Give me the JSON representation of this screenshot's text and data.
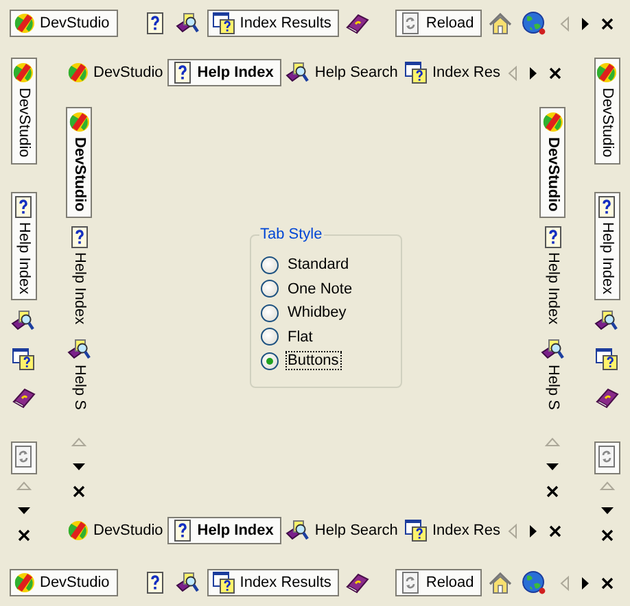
{
  "outer_top": {
    "kind": "button_groups",
    "groups": [
      {
        "tabs": [
          {
            "kind": "devstudio",
            "label": "DevStudio",
            "selected": true
          }
        ]
      },
      {
        "tabs": [
          {
            "kind": "help",
            "selected": false
          },
          {
            "kind": "search",
            "selected": false
          },
          {
            "kind": "results",
            "label": "Index Results",
            "selected": true
          },
          {
            "kind": "book",
            "selected": false
          }
        ]
      },
      {
        "tabs": [
          {
            "kind": "reload",
            "label": "Reload",
            "selected": true
          },
          {
            "kind": "home",
            "selected": false
          },
          {
            "kind": "globe",
            "selected": false
          }
        ]
      }
    ],
    "scroll_back": {
      "disabled": true
    },
    "scroll_forward": {
      "disabled": false
    }
  },
  "outer_left": {
    "kind": "button_groups",
    "groups": [
      {
        "tabs": [
          {
            "kind": "devstudio",
            "label": "DevStudio",
            "selected": true
          }
        ]
      },
      {
        "tabs": [
          {
            "kind": "help",
            "label": "Help Index",
            "selected": true
          },
          {
            "kind": "search",
            "selected": false
          },
          {
            "kind": "results",
            "selected": false
          },
          {
            "kind": "book",
            "selected": false
          }
        ]
      },
      {
        "tabs": [
          {
            "kind": "reload",
            "selected": true
          }
        ]
      }
    ],
    "scroll_back": {
      "disabled": true
    },
    "scroll_forward": {
      "disabled": false
    }
  },
  "inner_top": {
    "kind": "tab_list",
    "tabs": [
      {
        "kind": "devstudio",
        "label": "DevStudio",
        "selected": false
      },
      {
        "kind": "help",
        "label": "Help Index",
        "selected": true
      },
      {
        "kind": "search",
        "label": "Help Search",
        "selected": false
      },
      {
        "kind": "results",
        "label": "Index Res",
        "selected": false
      }
    ],
    "scroll_back": {
      "disabled": true
    },
    "scroll_forward": {
      "disabled": false
    }
  },
  "inner_left": {
    "kind": "tab_list",
    "tabs": [
      {
        "kind": "devstudio",
        "label": "DevStudio",
        "selected": true
      },
      {
        "kind": "help",
        "label": "Help Index",
        "selected": false
      },
      {
        "kind": "search",
        "label": "Help S",
        "selected": false
      }
    ],
    "scroll_back": {
      "disabled": true
    },
    "scroll_forward": {
      "disabled": false
    }
  },
  "tab_style": {
    "title": "Tab Style",
    "options": [
      {
        "label": "Standard",
        "selected": false
      },
      {
        "label": "One Note",
        "selected": false
      },
      {
        "label": "Whidbey",
        "selected": false
      },
      {
        "label": "Flat",
        "selected": false
      },
      {
        "label": "Buttons",
        "selected": true
      }
    ]
  },
  "inner_right": {
    "kind": "tab_list",
    "tabs": [
      {
        "kind": "devstudio",
        "label": "DevStudio",
        "selected": true
      },
      {
        "kind": "help",
        "label": "Help Index",
        "selected": false
      },
      {
        "kind": "search",
        "label": "Help S",
        "selected": false
      }
    ],
    "scroll_back": {
      "disabled": true
    },
    "scroll_forward": {
      "disabled": false
    }
  },
  "outer_right": {
    "kind": "button_groups",
    "groups": [
      {
        "tabs": [
          {
            "kind": "devstudio",
            "label": "DevStudio",
            "selected": true
          }
        ]
      },
      {
        "tabs": [
          {
            "kind": "help",
            "label": "Help Index",
            "selected": true
          },
          {
            "kind": "search",
            "selected": false
          },
          {
            "kind": "results",
            "selected": false
          },
          {
            "kind": "book",
            "selected": false
          }
        ]
      },
      {
        "tabs": [
          {
            "kind": "reload",
            "selected": true
          }
        ]
      }
    ],
    "scroll_back": {
      "disabled": true
    },
    "scroll_forward": {
      "disabled": false
    }
  },
  "inner_bottom": {
    "kind": "tab_list",
    "tabs": [
      {
        "kind": "devstudio",
        "label": "DevStudio",
        "selected": false
      },
      {
        "kind": "help",
        "label": "Help Index",
        "selected": true
      },
      {
        "kind": "search",
        "label": "Help Search",
        "selected": false
      },
      {
        "kind": "results",
        "label": "Index Res",
        "selected": false
      }
    ],
    "scroll_back": {
      "disabled": true
    },
    "scroll_forward": {
      "disabled": false
    }
  },
  "outer_bottom": {
    "kind": "button_groups",
    "groups": [
      {
        "tabs": [
          {
            "kind": "devstudio",
            "label": "DevStudio",
            "selected": true
          }
        ]
      },
      {
        "tabs": [
          {
            "kind": "help",
            "selected": false
          },
          {
            "kind": "search",
            "selected": false
          },
          {
            "kind": "results",
            "label": "Index Results",
            "selected": true
          },
          {
            "kind": "book",
            "selected": false
          }
        ]
      },
      {
        "tabs": [
          {
            "kind": "reload",
            "label": "Reload",
            "selected": true
          },
          {
            "kind": "home",
            "selected": false
          },
          {
            "kind": "globe",
            "selected": false
          }
        ]
      }
    ],
    "scroll_back": {
      "disabled": true
    },
    "scroll_forward": {
      "disabled": false
    }
  }
}
